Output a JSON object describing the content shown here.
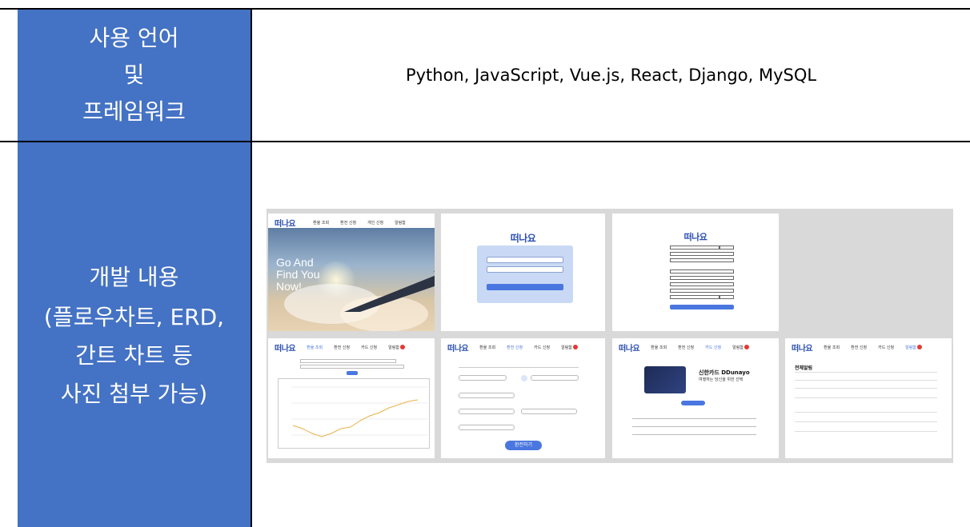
{
  "row1": {
    "label_lines": [
      "사용 언어",
      "및",
      "프레임워크"
    ],
    "content": "Python, JavaScript, Vue.js, React, Django, MySQL"
  },
  "row2": {
    "label_lines": [
      "개발 내용",
      "(플로우차트, ERD,",
      "간트 차트 등",
      "사진 첨부 가능)"
    ]
  },
  "colors": {
    "label_cell": "#4472c4",
    "accent_blue": "#4a76e0",
    "gallery_bg": "#d9d9d9"
  },
  "screens": {
    "logo": "떠나요",
    "nav": [
      "환율 조회",
      "환전 신청",
      "카드 신청",
      "알림함"
    ],
    "home": {
      "nav_alt": [
        "환율 조회",
        "환전 신청",
        "개인 신청",
        "알림함"
      ],
      "slogan": [
        "Go And",
        "Find You",
        "Now!"
      ]
    },
    "card": {
      "title": "신한카드 DDunayo",
      "subtitle": "여행하는 당신을 위한 선택"
    },
    "exchange": {
      "submit": "환전하기"
    },
    "notifications": {
      "title": "전체알림"
    }
  }
}
